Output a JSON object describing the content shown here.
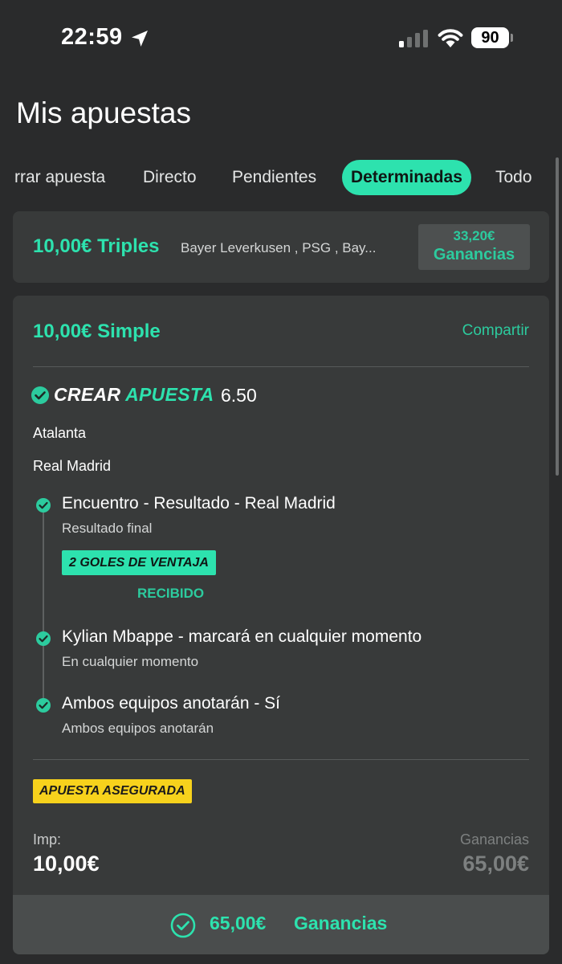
{
  "status_bar": {
    "time": "22:59",
    "battery": "90",
    "icons": [
      "location-arrow-icon",
      "signal-icon",
      "wifi-icon",
      "battery-icon"
    ]
  },
  "page_title": "Mis apuestas",
  "tabs": [
    {
      "label": "rrar apuesta",
      "active": false
    },
    {
      "label": "Directo",
      "active": false
    },
    {
      "label": "Pendientes",
      "active": false
    },
    {
      "label": "Determinadas",
      "active": true
    },
    {
      "label": "Todo",
      "active": false
    }
  ],
  "colors": {
    "accent": "#2de2ae",
    "accent_dim": "#2ccb9e",
    "background": "#2a2b2c",
    "card": "#383a3a",
    "insured_badge": "#f7d21c"
  },
  "triple_bet": {
    "title": "10,00€ Triples",
    "teams": "Bayer Leverkusen , PSG , Bay...",
    "winnings_amount": "33,20€",
    "winnings_label": "Ganancias"
  },
  "single_bet": {
    "title": "10,00€ Simple",
    "share": "Compartir",
    "bet_builder": {
      "label_part1": "CREAR",
      "label_part2": "APUESTA",
      "odds": "6.50"
    },
    "home_team": "Atalanta",
    "away_team": "Real Madrid",
    "legs": [
      {
        "title": "Encuentro - Resultado - Real Madrid",
        "subtitle": "Resultado final"
      },
      {
        "title": "Kylian Mbappe - marcará en cualquier momento",
        "subtitle": "En cualquier momento"
      },
      {
        "title": "Ambos equipos anotarán - Sí",
        "subtitle": "Ambos equipos anotarán"
      }
    ],
    "boost_badge": "2 GOLES DE VENTAJA",
    "boost_status": "RECIBIDO",
    "insured_badge": "APUESTA ASEGURADA",
    "stake_label": "Imp:",
    "stake_value": "10,00€",
    "winnings_label": "Ganancias",
    "winnings_value": "65,00€",
    "footer": {
      "amount": "65,00€",
      "label": "Ganancias"
    }
  }
}
